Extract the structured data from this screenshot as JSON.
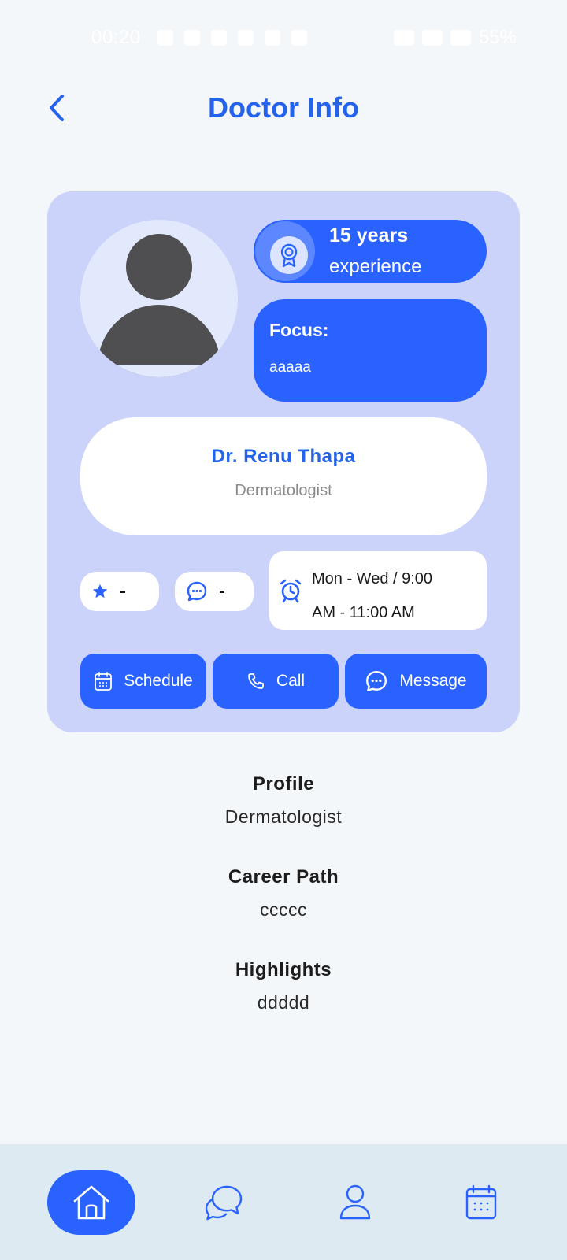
{
  "status_bar": {
    "time": "00:20",
    "battery": "55%"
  },
  "header": {
    "title": "Doctor Info"
  },
  "doctor": {
    "experience_years": "15 years",
    "experience_label": "experience",
    "focus_title": "Focus:",
    "focus_value": "aaaaa",
    "name": "Dr. Renu Thapa",
    "specialty": "Dermatologist",
    "rating": "-",
    "reviews": "-",
    "schedule_line1": "Mon - Wed / 9:00",
    "schedule_line2": "AM - 11:00 AM"
  },
  "actions": {
    "schedule_label": "Schedule",
    "call_label": "Call",
    "message_label": "Message"
  },
  "info": {
    "profile_title": "Profile",
    "profile_value": "Dermatologist",
    "career_title": "Career Path",
    "career_value": "ccccc",
    "highlights_title": "Highlights",
    "highlights_value": "ddddd"
  },
  "bottom_nav": {
    "items": [
      {
        "icon": "home-icon",
        "active": true
      },
      {
        "icon": "chat-icon",
        "active": false
      },
      {
        "icon": "user-icon",
        "active": false
      },
      {
        "icon": "calendar-icon",
        "active": false
      }
    ]
  },
  "colors": {
    "primary": "#2962ff",
    "title_blue": "#2563eb",
    "card_bg": "#cbd3fb",
    "page_bg": "#f3f7fa",
    "nav_bg": "#ddeaf1"
  }
}
